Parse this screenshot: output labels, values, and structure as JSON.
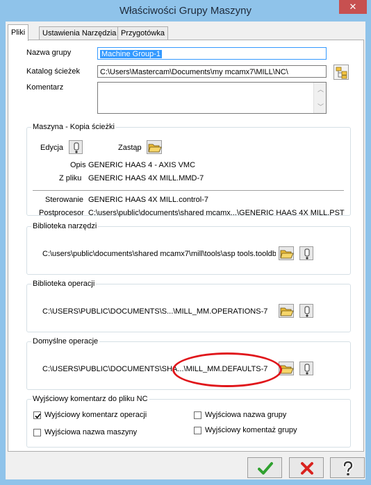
{
  "window": {
    "title": "Właściwości Grupy Maszyny",
    "close_glyph": "✕"
  },
  "tabs": [
    {
      "label": "Pliki",
      "active": true
    },
    {
      "label": "Ustawienia Narzędzia",
      "active": false
    },
    {
      "label": "Przygotówka",
      "active": false
    }
  ],
  "general": {
    "group_name_label": "Nazwa grupy",
    "group_name_value": "Machine Group-1",
    "path_label": "Katalog ścieżek",
    "path_value": "C:\\Users\\Mastercam\\Documents\\my mcamx7\\MILL\\NC\\",
    "comment_label": "Komentarz",
    "comment_value": ""
  },
  "machine": {
    "title": "Maszyna - Kopia ścieżki",
    "edit_label": "Edycja",
    "replace_label": "Zastąp",
    "desc_label": "Opis",
    "desc_value": "GENERIC HAAS 4 - AXIS VMC",
    "file_label": "Z pliku",
    "file_value": "GENERIC HAAS 4X MILL.MMD-7",
    "control_label": "Sterowanie",
    "control_value": "GENERIC HAAS 4X MILL.control-7",
    "post_label": "Postprocesor",
    "post_value": "C:\\users\\public\\documents\\shared mcamx...\\GENERIC HAAS 4X MILL.PST"
  },
  "tool_library": {
    "title": "Biblioteka narzędzi",
    "path": "C:\\users\\public\\documents\\shared mcamx7\\mill\\tools\\asp tools.tooldb"
  },
  "ops_library": {
    "title": "Biblioteka operacji",
    "path": "C:\\USERS\\PUBLIC\\DOCUMENTS\\S...\\MILL_MM.OPERATIONS-7"
  },
  "default_ops": {
    "title": "Domyślne operacje",
    "path": "C:\\USERS\\PUBLIC\\DOCUMENTS\\SHA...\\MILL_MM.DEFAULTS-7"
  },
  "nc_comment": {
    "title": "Wyjściowy komentarz do pliku NC",
    "items": [
      {
        "label": "Wyjściowy komentarz operacji",
        "checked": true
      },
      {
        "label": "Wyjściowa nazwa grupy",
        "checked": false
      },
      {
        "label": "Wyjściowa nazwa maszyny",
        "checked": false
      },
      {
        "label": "Wyjściowy komentaż grupy",
        "checked": false
      }
    ]
  },
  "buttons": {
    "ok": "ok-icon",
    "cancel": "cancel-icon",
    "help": "help-icon"
  },
  "colors": {
    "titlebar": "#8fc3ea",
    "close": "#c75050",
    "highlight": "#3399ff",
    "annotation": "#e0161b",
    "ok_green": "#2fa12f",
    "cancel_red": "#d9231f"
  }
}
